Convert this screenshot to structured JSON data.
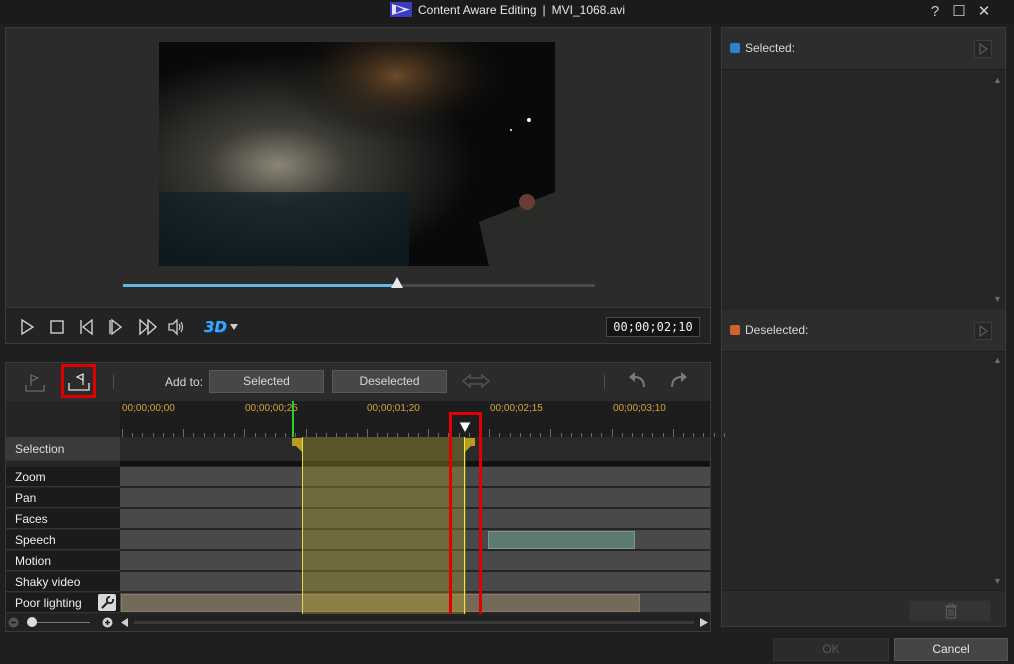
{
  "window": {
    "title_app": "Content Aware Editing",
    "title_sep": "|",
    "title_file": "MVI_1068.avi",
    "help": "?",
    "maximize": "☐",
    "close": "✕"
  },
  "preview": {
    "progress": 0.58,
    "timecode": "00;00;02;10",
    "stereo_label": "3D"
  },
  "timeline": {
    "add_to_label": "Add to:",
    "selected_button": "Selected",
    "deselected_button": "Deselected",
    "ruler_labels": [
      "00;00;00;00",
      "00;00;00;25",
      "00;00;01;20",
      "00;00;02;15",
      "00;00;03;10"
    ],
    "rows": [
      "Selection",
      "Zoom",
      "Pan",
      "Faces",
      "Speech",
      "Motion",
      "Shaky video",
      "Poor lighting"
    ]
  },
  "right_panel": {
    "selected_label": "Selected:",
    "deselected_label": "Deselected:",
    "colors": {
      "selected": "#2f7fd6",
      "deselected": "#d0622a"
    }
  },
  "footer": {
    "ok_label": "OK",
    "cancel_label": "Cancel"
  }
}
